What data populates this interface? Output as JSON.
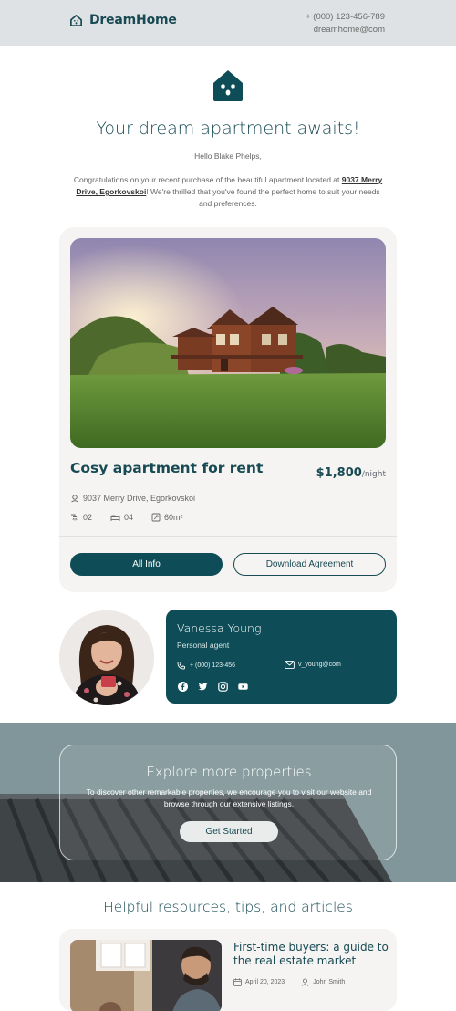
{
  "header": {
    "brand": "DreamHome",
    "phone": "+ (000) 123-456-789",
    "email": "dreamhome@com"
  },
  "hero": {
    "title": "Your dream apartment awaits!",
    "greeting": "Hello Blake Phelps,",
    "intro_before": "Congratulations on your recent purchase of the beautiful apartment located at",
    "intro_address": "9037 Merry Drive, Egorkovskoi",
    "intro_after": "! We're thrilled that you've found the perfect home to suit your needs and preferences."
  },
  "listing": {
    "title": "Cosy apartment for rent",
    "price": "$1,800",
    "price_unit": "/night",
    "address": "9037 Merry Drive, Egorkovskoi",
    "baths": "02",
    "beds": "04",
    "area": "60m²",
    "btn_info": "All Info",
    "btn_download": "Download Agreement"
  },
  "agent": {
    "name": "Vanessa Young",
    "role": "Personal agent",
    "phone": "+ (000) 123-456",
    "email": "v_young@com"
  },
  "explore": {
    "title": "Explore more properties",
    "text": "To discover other remarkable properties, we encourage you to visit our website and browse through our extensive listings.",
    "button": "Get Started"
  },
  "resources": {
    "title": "Helpful resources, tips, and articles",
    "article_title": "First-time buyers: a guide to the real estate market",
    "article_date": "April 20, 2023",
    "article_author": "John Smith"
  },
  "colors": {
    "primary": "#0e4d57",
    "heading": "#174a53",
    "card_bg": "#f5f4f2",
    "topbar_bg": "#dfe2e4"
  }
}
